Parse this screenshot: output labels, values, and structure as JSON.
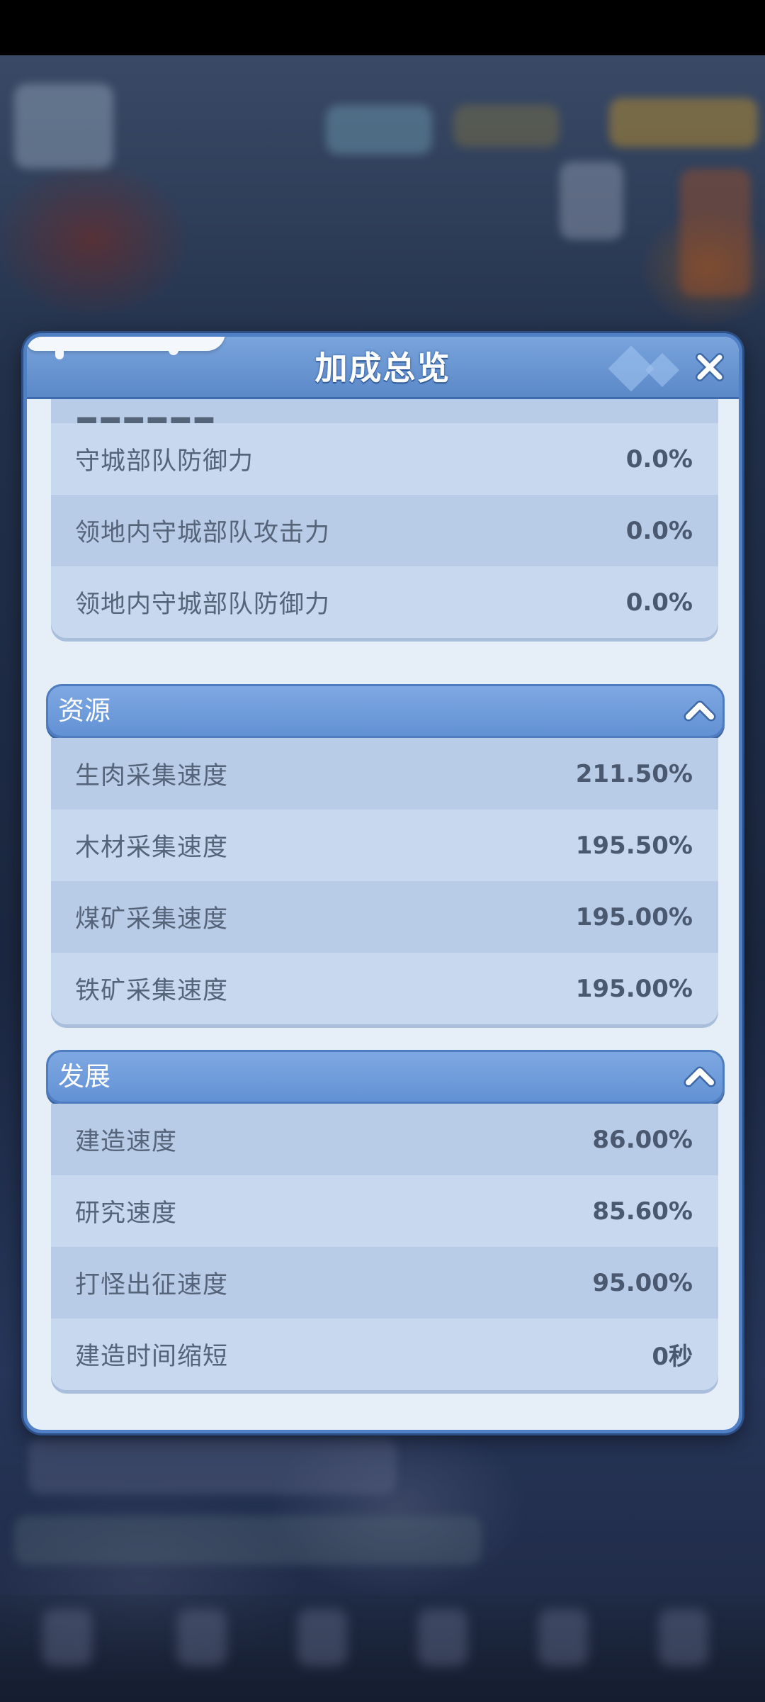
{
  "dialog": {
    "title": "加成总览"
  },
  "top_section": {
    "rows": [
      {
        "label": "守城部队防御力",
        "value": "0.0%"
      },
      {
        "label": "领地内守城部队攻击力",
        "value": "0.0%"
      },
      {
        "label": "领地内守城部队防御力",
        "value": "0.0%"
      }
    ]
  },
  "resources": {
    "title": "资源",
    "rows": [
      {
        "label": "生肉采集速度",
        "value": "211.50%"
      },
      {
        "label": "木材采集速度",
        "value": "195.50%"
      },
      {
        "label": "煤矿采集速度",
        "value": "195.00%"
      },
      {
        "label": "铁矿采集速度",
        "value": "195.00%"
      }
    ]
  },
  "development": {
    "title": "发展",
    "rows": [
      {
        "label": "建造速度",
        "value": "86.00%"
      },
      {
        "label": "研究速度",
        "value": "85.60%"
      },
      {
        "label": "打怪出征速度",
        "value": "95.00%"
      },
      {
        "label": "建造时间缩短",
        "value": "0秒"
      }
    ]
  },
  "icons": {
    "close": "close-x-icon",
    "collapse": "chevron-up-icon"
  },
  "colors": {
    "header_blue": "#6291d4",
    "row_dark": "#b8cce8",
    "row_light": "#c8d9ef",
    "panel": "#e6eef8"
  }
}
